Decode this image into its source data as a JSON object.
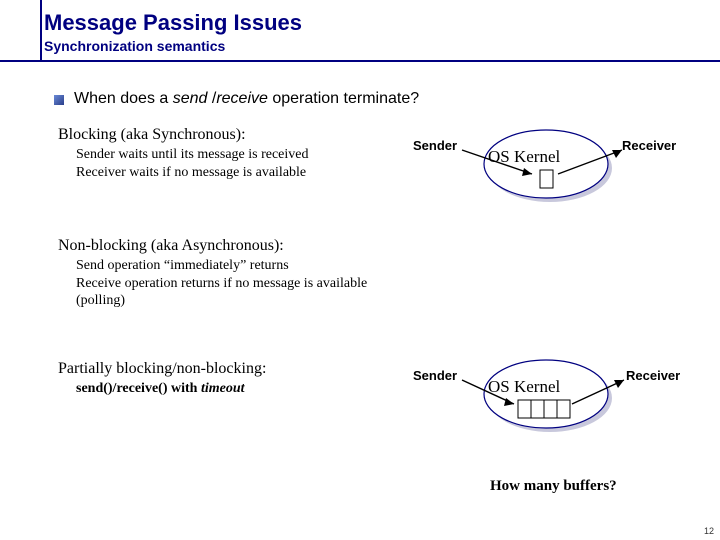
{
  "header": {
    "title": "Message Passing Issues",
    "subtitle": "Synchronization semantics"
  },
  "question": {
    "prefix": "When does a ",
    "em1": "send",
    "mid": " /",
    "em2": "receive",
    "suffix": " operation terminate?"
  },
  "blocking": {
    "head": "Blocking (aka Synchronous):",
    "line1": "Sender waits until its message is received",
    "line2": "Receiver waits if no message is available"
  },
  "nonblocking": {
    "head": "Non-blocking (aka Asynchronous):",
    "line1": "Send operation “immediately” returns",
    "line2": "Receive operation returns if no message is available (polling)"
  },
  "partial": {
    "head": "Partially blocking/non-blocking:",
    "body_pre": "send()/receive() with ",
    "body_em": "timeout"
  },
  "diagram1": {
    "sender": "Sender",
    "receiver": "Receiver",
    "kernel": "OS Kernel"
  },
  "diagram2": {
    "sender": "Sender",
    "receiver": "Receiver",
    "kernel": "OS Kernel"
  },
  "howmany": "How many buffers?",
  "pagenum": "12"
}
